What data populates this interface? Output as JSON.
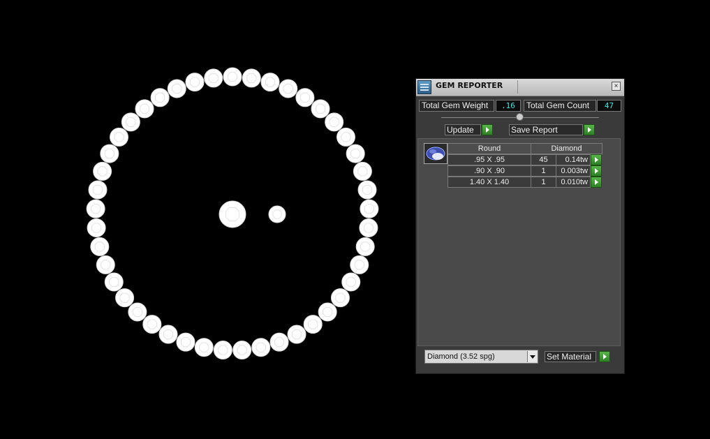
{
  "viewport": {
    "stone_color": "#ffffff",
    "stone_facet_color": "#dcdcdc"
  },
  "panel": {
    "title": "GEM REPORTER",
    "close_glyph": "×",
    "total_gem_weight_label": "Total Gem Weight",
    "total_gem_weight_value": ".16",
    "total_gem_count_label": "Total Gem Count",
    "total_gem_count_value": "47",
    "update_label": "Update",
    "save_report_label": "Save Report",
    "table": {
      "headers": [
        "Round",
        "Diamond"
      ],
      "rows": [
        {
          "size": ".95 X .95",
          "count": "45",
          "weight": "0.14tw"
        },
        {
          "size": ".90 X .90",
          "count": "1",
          "weight": "0.003tw"
        },
        {
          "size": "1.40 X 1.40",
          "count": "1",
          "weight": "0.010tw"
        }
      ]
    },
    "material_select_value": "Diamond      (3.52 spg)",
    "set_material_label": "Set Material",
    "accent_value_color": "#4fe1dd",
    "go_button_color": "#3f9a33"
  }
}
